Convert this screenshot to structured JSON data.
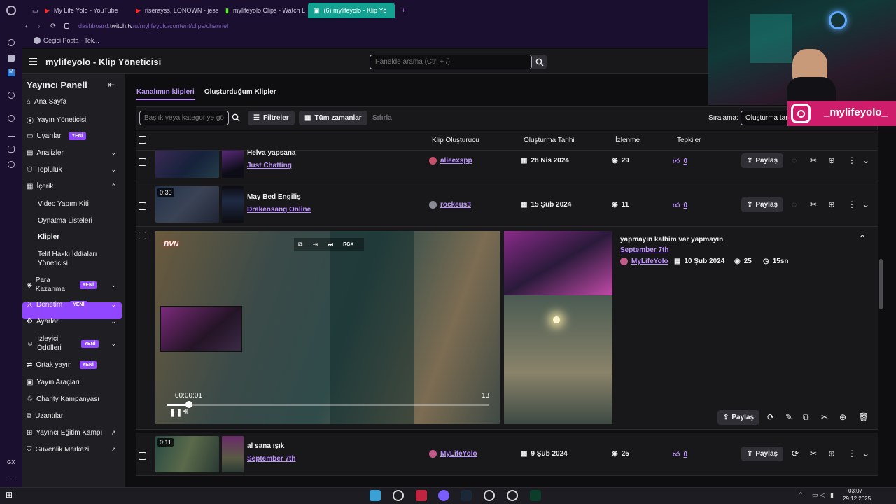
{
  "browser": {
    "tabs": [
      {
        "label": "My Life Yolo - YouTube",
        "active": false
      },
      {
        "label": "riserayss, LONOWN - jess",
        "active": false
      },
      {
        "label": "mylifeyolo Clips - Watch L",
        "active": false
      },
      {
        "label": "(6) mylifeyolo - Klip Yö",
        "active": true
      }
    ],
    "url_prefix": "dashboard.",
    "url_domain": "twitch.tv",
    "url_path": "/u/mylifeyolo/content/clips/channel",
    "bookmark": "Geçici Posta - Tek..."
  },
  "header": {
    "title": "mylifeyolo - Klip Yöneticisi",
    "search_placeholder": "Panelde arama (Ctrl + /)"
  },
  "sidebar": {
    "heading": "Yayıncı Paneli",
    "badge_new": "YENİ",
    "items": [
      {
        "label": "Ana Sayfa",
        "icon": "home-icon"
      },
      {
        "label": "Yayın Yöneticisi",
        "icon": "broadcast-icon"
      },
      {
        "label": "Uyarılar",
        "icon": "alert-icon",
        "badge": true
      },
      {
        "label": "Analizler",
        "icon": "chart-icon",
        "expandable": true
      },
      {
        "label": "Topluluk",
        "icon": "community-icon",
        "expandable": true
      },
      {
        "label": "İçerik",
        "icon": "content-icon",
        "expanded": true
      }
    ],
    "content_sub": [
      "Video Yapım Kiti",
      "Oynatma Listeleri",
      "Klipler",
      "Telif Hakkı İddiaları Yöneticisi"
    ],
    "items_after": [
      {
        "label": "Para Kazanma",
        "icon": "money-icon",
        "badge": true,
        "expandable": true
      },
      {
        "label": "Denetim",
        "icon": "moderation-icon",
        "badge": true,
        "expandable": true
      },
      {
        "label": "Ayarlar",
        "icon": "settings-icon",
        "expandable": true
      },
      {
        "label": "İzleyici Ödülleri",
        "icon": "rewards-icon",
        "badge": true,
        "expandable": true
      },
      {
        "label": "Ortak yayın",
        "icon": "collab-icon",
        "badge": true
      },
      {
        "label": "Yayın Araçları",
        "icon": "tools-icon"
      },
      {
        "label": "Charity Kampanyası",
        "icon": "charity-icon"
      },
      {
        "label": "Uzantılar",
        "icon": "extensions-icon"
      },
      {
        "label": "Yayıncı Eğitim Kampı",
        "icon": "education-icon",
        "external": true
      },
      {
        "label": "Güvenlik Merkezi",
        "icon": "safety-icon",
        "external": true
      }
    ]
  },
  "main": {
    "tabs": [
      "Kanalımın klipleri",
      "Oluşturduğum Klipler"
    ],
    "filter_placeholder": "Başlık veya kategoriye gö",
    "filters_label": "Filtreler",
    "time_label": "Tüm zamanlar",
    "reset_label": "Sıfırla",
    "sort_label": "Sıralama:",
    "sort_value": "Oluşturma tar",
    "columns": [
      "Klip Oluşturucu",
      "Oluşturma Tarihi",
      "İzlenme",
      "Tepkiler"
    ],
    "share_label": "Paylaş",
    "rows": [
      {
        "title": "Helva yapsana",
        "category": "Just Chatting",
        "creator": "alieexspp",
        "date": "28 Nis 2024",
        "views": "29",
        "reactions": "0"
      },
      {
        "title": "May Bed Engiliş",
        "category": "Drakensang Online",
        "creator": "rockeus3",
        "date": "15 Şub 2024",
        "views": "11",
        "reactions": "0",
        "duration": "0:30"
      }
    ],
    "expanded": {
      "title": "yapmayın kalbim var yapmayın",
      "category": "September 7th",
      "creator": "MyLifeYolo",
      "date": "10 Şub 2024",
      "views": "25",
      "duration": "15sn",
      "time_current": "00:00:01",
      "time_end": "13",
      "progress_fraction": 0.07,
      "overlay_logo": "BVN",
      "ctrl_label": "RGX"
    },
    "last_row": {
      "title": "al sana ışık",
      "category": "September 7th",
      "creator": "MyLifeYolo",
      "date": "9 Şub 2024",
      "views": "25",
      "reactions": "0",
      "duration": "0:11"
    }
  },
  "overlay": {
    "ig_handle": "_mylifeyolo_"
  },
  "taskbar": {
    "time": "03:07",
    "date": "29.12.2025"
  },
  "colors": {
    "accent": "#9147ff",
    "link": "#bf94ff",
    "browser_bg": "#1a0f2e",
    "active_tab": "#15a192",
    "instagram": "#cf1d6c"
  }
}
